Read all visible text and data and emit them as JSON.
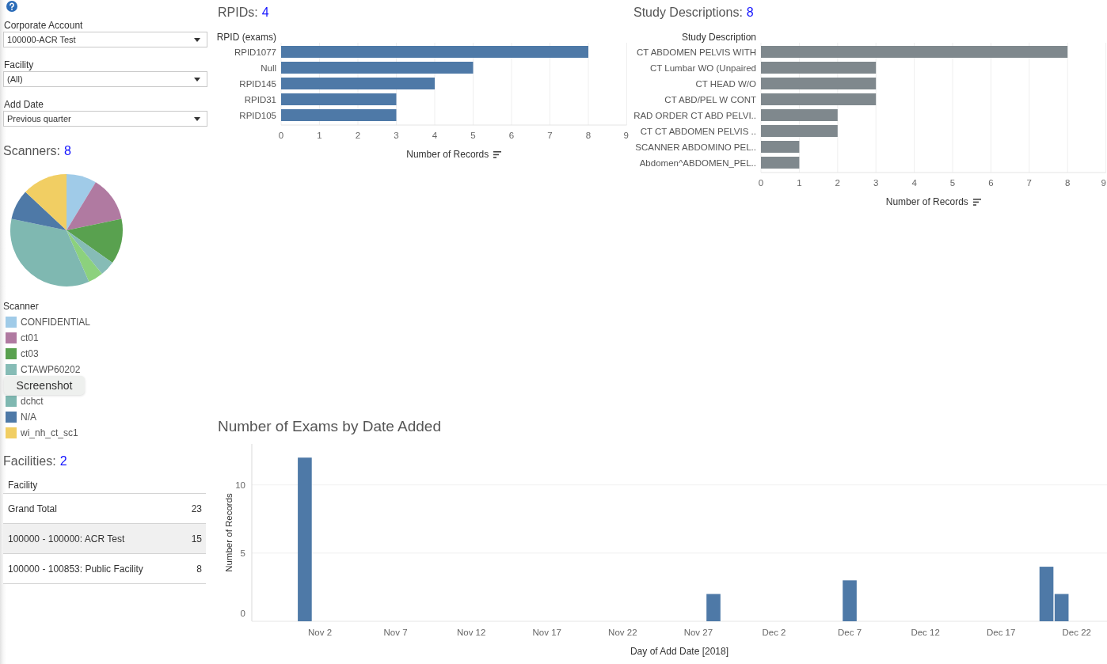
{
  "filters": [
    {
      "label": "Corporate Account",
      "value": "100000-ACR Test"
    },
    {
      "label": "Facility",
      "value": "(All)"
    },
    {
      "label": "Add Date",
      "value": "Previous quarter"
    }
  ],
  "scanners": {
    "title": "Scanners:",
    "count": "8",
    "legend_title": "Scanner",
    "legend": [
      {
        "kind": "swatch",
        "label": "CONFIDENTIAL",
        "color": "#a0cbe8"
      },
      {
        "kind": "swatch",
        "label": "ct01",
        "color": "#b07aa1"
      },
      {
        "kind": "swatch",
        "label": "ct03",
        "color": "#59a14f"
      },
      {
        "kind": "swatch",
        "label": "CTAWP60202",
        "color": "#86bcb6"
      },
      {
        "kind": "tooltip",
        "label": "Screenshot"
      },
      {
        "kind": "swatch",
        "label": "dchct",
        "color": "#7fb8b1"
      },
      {
        "kind": "swatch",
        "label": "N/A",
        "color": "#4e79a7"
      },
      {
        "kind": "swatch",
        "label": "wi_nh_ct_sc1",
        "color": "#f1ce63"
      }
    ]
  },
  "facilities": {
    "title": "Facilities:",
    "count": "2",
    "column": "Facility",
    "rows": [
      {
        "name": "Grand Total",
        "value": "23",
        "highlighted": false
      },
      {
        "name": "100000 - 100000: ACR Test",
        "value": "15",
        "highlighted": true
      },
      {
        "name": "100000 - 100853: Public Facility",
        "value": "8",
        "highlighted": false
      }
    ]
  },
  "rpids": {
    "title": "RPIDs:",
    "count": "4",
    "chart_data": [
      {
        "type": "bar",
        "orientation": "horizontal",
        "ylabel": "RPID (exams)",
        "xlabel": "Number of Records",
        "categories": [
          "RPID1077",
          "Null",
          "RPID145",
          "RPID31",
          "RPID105"
        ],
        "values": [
          8,
          5,
          4,
          3,
          3
        ],
        "color": "#4e79a7",
        "xlim": [
          0,
          9
        ],
        "xticks": [
          0,
          1,
          2,
          3,
          4,
          5,
          6,
          7,
          8,
          9
        ],
        "grid": true
      }
    ]
  },
  "study_descriptions": {
    "title": "Study Descriptions:",
    "count": "8",
    "chart_data": [
      {
        "type": "bar",
        "orientation": "horizontal",
        "ylabel": "Study Description",
        "xlabel": "Number of Records",
        "categories": [
          "CT ABDOMEN PELVIS WITH",
          "CT Lumbar WO (Unpaired",
          "CT HEAD W/O",
          "CT ABD/PEL W CONT",
          "RAD ORDER CT ABD PELVI..",
          "CT CT ABDOMEN PELVIS ..",
          "SCANNER ABDOMINO PEL..",
          "Abdomen^ABDOMEN_PEL.."
        ],
        "values": [
          8,
          3,
          3,
          3,
          2,
          2,
          1,
          1
        ],
        "color": "#7f888d",
        "xlim": [
          0,
          9
        ],
        "xticks": [
          0,
          1,
          2,
          3,
          4,
          5,
          6,
          7,
          8,
          9
        ],
        "grid": true
      }
    ]
  },
  "exams_by_date": {
    "chart_data": [
      {
        "type": "bar",
        "title": "Number of Exams by Date Added",
        "xlabel": "Day of Add Date [2018]",
        "ylabel": "Number of Records",
        "x": [
          "2018-11-01",
          "2018-11-28",
          "2018-12-07",
          "2018-12-20",
          "2018-12-21"
        ],
        "values": [
          12,
          2,
          3,
          4,
          2
        ],
        "color": "#4e79a7",
        "xlim": [
          "2018-10-28T12:00",
          "2018-12-24"
        ],
        "ylim": [
          0,
          13
        ],
        "yticks": [
          0,
          5,
          10
        ],
        "xticks": [
          {
            "value": "2018-11-02",
            "label": "Nov 2"
          },
          {
            "value": "2018-11-07",
            "label": "Nov 7"
          },
          {
            "value": "2018-11-12",
            "label": "Nov 12"
          },
          {
            "value": "2018-11-17",
            "label": "Nov 17"
          },
          {
            "value": "2018-11-22",
            "label": "Nov 22"
          },
          {
            "value": "2018-11-27",
            "label": "Nov 27"
          },
          {
            "value": "2018-12-02",
            "label": "Dec 2"
          },
          {
            "value": "2018-12-07",
            "label": "Dec 7"
          },
          {
            "value": "2018-12-12",
            "label": "Dec 12"
          },
          {
            "value": "2018-12-17",
            "label": "Dec 17"
          },
          {
            "value": "2018-12-22",
            "label": "Dec 22"
          }
        ],
        "grid": true
      }
    ]
  }
}
